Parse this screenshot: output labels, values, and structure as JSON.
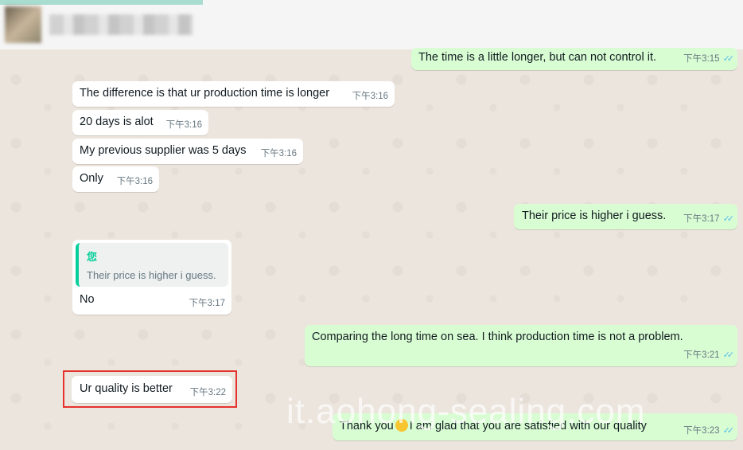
{
  "chat": {
    "messages": [
      {
        "dir": "out",
        "text": "The time is a little longer, but can not control it.",
        "time": "下午3:15",
        "ticks": "✓✓"
      },
      {
        "dir": "in",
        "text": "The difference is that ur production time is longer",
        "time": "下午3:16"
      },
      {
        "dir": "in",
        "text": "20 days is alot",
        "time": "下午3:16"
      },
      {
        "dir": "in",
        "text": "My previous supplier was 5 days",
        "time": "下午3:16"
      },
      {
        "dir": "in",
        "text": "Only",
        "time": "下午3:16"
      },
      {
        "dir": "out",
        "text": "Their price is higher i guess.",
        "time": "下午3:17",
        "ticks": "✓✓"
      },
      {
        "dir": "in",
        "quote_author": "您",
        "quote_text": "Their price is higher i guess.",
        "text": "No",
        "time": "下午3:17"
      },
      {
        "dir": "out",
        "text": "Comparing the long time on sea.  I think production time is not a problem.",
        "time": "下午3:21",
        "ticks": "✓✓"
      },
      {
        "dir": "in",
        "text": "Ur quality is better",
        "time": "下午3:22"
      },
      {
        "dir": "out",
        "text_a": "Thank you",
        "text_b": "I am glad that you are satisfied with our quality",
        "time": "下午3:23",
        "ticks": "✓✓"
      }
    ]
  },
  "watermark": "it.aohong-sealing.com"
}
